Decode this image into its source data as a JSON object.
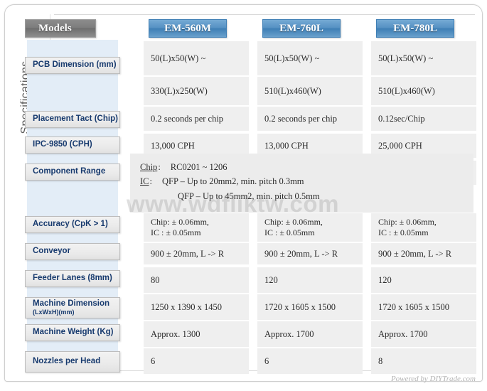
{
  "frame": {
    "side_title": "Specifications",
    "footer_credit": "Powered by DIYTrade.com",
    "watermark": "www.wdfliktw.com",
    "accent_blue": "#3f7fb5",
    "label_text_blue": "#173a6e",
    "header_gray": "#7d7d7d",
    "band_blue": "#e3edf7",
    "value_cell_gray": "#efefef"
  },
  "header": {
    "models_label": "Models",
    "columns": [
      {
        "label": "EM-560M"
      },
      {
        "label": "EM-760L"
      },
      {
        "label": "EM-780L"
      }
    ]
  },
  "rows": [
    {
      "label": "PCB Dimension (mm)",
      "sub": "",
      "values": [
        "50(L)x50(W) ~",
        "50(L)x50(W) ~",
        "50(L)x50(W) ~"
      ]
    },
    {
      "label": "",
      "sub": "",
      "values": [
        "330(L)x250(W)",
        "510(L)x460(W)",
        "510(L)x460(W)"
      ]
    },
    {
      "label": "Placement Tact (Chip)",
      "sub": "",
      "values": [
        "0.2 seconds per chip",
        "0.2 seconds per chip",
        "0.12sec/Chip"
      ]
    },
    {
      "label": "IPC-9850 (CPH)",
      "sub": "",
      "values": [
        "13,000 CPH",
        "13,000 CPH",
        "25,000 CPH"
      ]
    },
    {
      "label": "Component Range",
      "sub": "",
      "values": [
        "",
        "",
        ""
      ]
    },
    {
      "label": "Accuracy (CpK > 1)",
      "sub": "",
      "values": [
        "Chip: ± 0.06mm,|IC : ± 0.05mm",
        "Chip: ± 0.06mm,|IC : ± 0.05mm",
        "Chip: ± 0.06mm,|IC : ± 0.05mm"
      ]
    },
    {
      "label": "Conveyor",
      "sub": "",
      "values": [
        "900 ± 20mm, L -> R",
        "900 ± 20mm, L -> R",
        "900 ± 20mm, L -> R"
      ]
    },
    {
      "label": "Feeder Lanes (8mm)",
      "sub": "",
      "values": [
        "80",
        "120",
        "120"
      ]
    },
    {
      "label": "Machine Dimension",
      "sub": "(LxWxH)(mm)",
      "values": [
        "1250 x 1390 x 1450",
        "1720 x 1605 x 1500",
        "1720 x 1605 x 1500"
      ]
    },
    {
      "label": "Machine Weight (Kg)",
      "sub": "",
      "values": [
        "Approx. 1300",
        "Approx. 1700",
        "Approx. 1700"
      ]
    },
    {
      "label": "Nozzles per Head",
      "sub": "",
      "values": [
        "6",
        "6",
        "8"
      ]
    }
  ],
  "note_panel": {
    "lines": [
      {
        "key": "Chip",
        "colon": ":",
        "value": "RC0201 ~ 1206",
        "indent": false
      },
      {
        "key": "IC",
        "colon": ":",
        "value": "QFP – Up to 20mm2, min. pitch 0.3mm",
        "indent": false
      },
      {
        "key": "",
        "colon": "",
        "value": "QFP – Up to 45mm2, min. pitch 0.5mm",
        "indent": true
      }
    ]
  }
}
